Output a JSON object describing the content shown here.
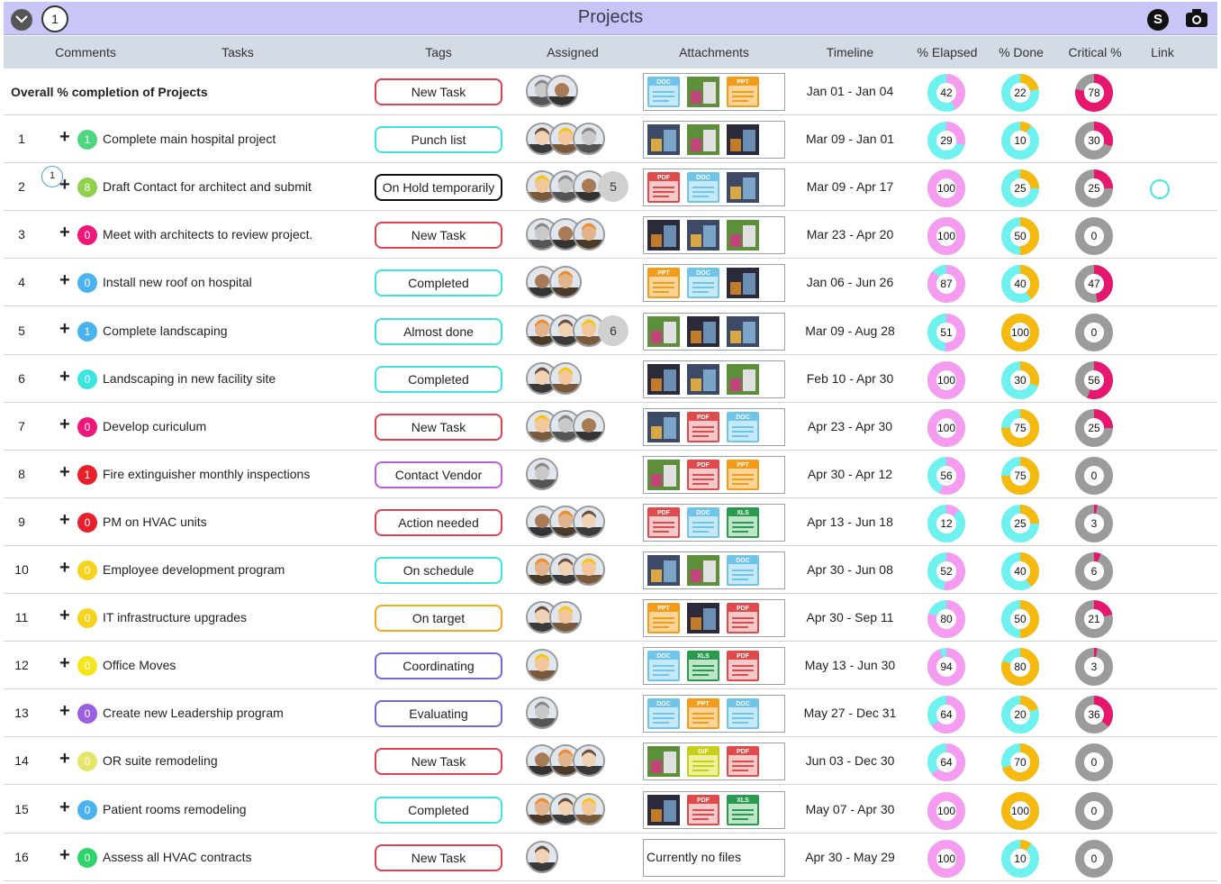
{
  "title": "Projects",
  "comment_count": "1",
  "skype_label": "S",
  "columns": [
    "Comments",
    "Tasks",
    "Tags",
    "Assigned",
    "Attachments",
    "Timeline",
    "% Elapsed",
    "% Done",
    "Critical %",
    "Link"
  ],
  "overall": {
    "label": "Overall % completion of Projects",
    "tag": "New Task",
    "timeline": "Jan 01 - Jan 04",
    "elapsed": 42,
    "done": 22,
    "critical": 78
  },
  "colors": {
    "red_tag": "#e0404f",
    "cyan_tag": "#3de3df",
    "purple_tag": "#b75fe0",
    "orange_tag": "#f5a81e",
    "indigo_tag": "#7b63dd",
    "black_tag": "#111111",
    "elapsed_pink": "#f59cf0",
    "elapsed_cyan": "#6ff2ef",
    "done_orange": "#f5b90f",
    "done_cyan": "#6ff2ef",
    "crit_pink": "#e5176e",
    "crit_gray": "#9b9b9b"
  },
  "rows": [
    {
      "num": "1",
      "badge": "1",
      "badge_color": "#4dd67f",
      "task": "Complete main hospital project",
      "tag": "Punch list",
      "tag_color": "#3de3df",
      "assigned": 3,
      "more": "",
      "files": [
        "photo",
        "photo",
        "photo"
      ],
      "timeline": "Mar 09 - Jan 01",
      "elapsed": 29,
      "done": 10,
      "critical": 30
    },
    {
      "num": "2",
      "badge": "8",
      "badge_color": "#8fd14f",
      "task": "Draft Contact for architect and submit",
      "tag": "On Hold temporarily",
      "tag_color": "#111111",
      "assigned": 3,
      "more": "5",
      "files": [
        "pdf",
        "doc",
        "photo"
      ],
      "timeline": "Mar 09 - Apr 17",
      "elapsed": 100,
      "done": 25,
      "critical": 25,
      "bubble": "1",
      "link": true
    },
    {
      "num": "3",
      "badge": "0",
      "badge_color": "#f0177a",
      "task": "Meet with architects to review project.",
      "tag": "New Task",
      "tag_color": "#e0404f",
      "assigned": 3,
      "more": "",
      "files": [
        "photo",
        "photo",
        "photo"
      ],
      "timeline": "Mar 23 - Apr 20",
      "elapsed": 100,
      "done": 50,
      "critical": 0
    },
    {
      "num": "4",
      "badge": "0",
      "badge_color": "#4ab3ef",
      "task": "Install new roof on hospital",
      "tag": "Completed",
      "tag_color": "#3de3df",
      "assigned": 2,
      "more": "",
      "files": [
        "ppt",
        "doc",
        "photo"
      ],
      "timeline": "Jan 06 - Jun 26",
      "elapsed": 87,
      "done": 40,
      "critical": 47
    },
    {
      "num": "5",
      "badge": "1",
      "badge_color": "#4ab3ef",
      "task": "Complete landscaping",
      "tag": "Almost done",
      "tag_color": "#3de3df",
      "assigned": 3,
      "more": "6",
      "files": [
        "photo",
        "photo",
        "photo"
      ],
      "timeline": "Mar 09 - Aug 28",
      "elapsed": 51,
      "done": 100,
      "critical": 0
    },
    {
      "num": "6",
      "badge": "0",
      "badge_color": "#3de3df",
      "task": "Landscaping in new facility site",
      "tag": "Completed",
      "tag_color": "#3de3df",
      "assigned": 2,
      "more": "",
      "files": [
        "photo",
        "photo",
        "photo"
      ],
      "timeline": "Feb 10 - Apr 30",
      "elapsed": 100,
      "done": 30,
      "critical": 56
    },
    {
      "num": "7",
      "badge": "0",
      "badge_color": "#f0177a",
      "task": "Develop curiculum",
      "tag": "New Task",
      "tag_color": "#e0404f",
      "assigned": 3,
      "more": "",
      "files": [
        "photo",
        "pdf",
        "doc"
      ],
      "timeline": "Apr 23 - Apr 30",
      "elapsed": 100,
      "done": 75,
      "critical": 25
    },
    {
      "num": "8",
      "badge": "1",
      "badge_color": "#e8202a",
      "task": "Fire extinguisher monthly inspections",
      "tag": "Contact Vendor",
      "tag_color": "#b75fe0",
      "assigned": 1,
      "more": "",
      "files": [
        "photo",
        "pdf",
        "ppt"
      ],
      "timeline": "Apr 30 - Apr 12",
      "elapsed": 56,
      "done": 75,
      "critical": 0
    },
    {
      "num": "9",
      "badge": "0",
      "badge_color": "#e8202a",
      "task": "PM on HVAC units",
      "tag": "Action needed",
      "tag_color": "#e0404f",
      "assigned": 3,
      "more": "",
      "files": [
        "pdf",
        "doc",
        "xls"
      ],
      "timeline": "Apr 13 - Jun 18",
      "elapsed": 12,
      "done": 25,
      "critical": 3
    },
    {
      "num": "10",
      "badge": "0",
      "badge_color": "#f5d31e",
      "task": "Employee development program",
      "tag": "On schedule",
      "tag_color": "#3de3df",
      "assigned": 3,
      "more": "",
      "files": [
        "photo",
        "photo",
        "doc"
      ],
      "timeline": "Apr 30 - Jun 08",
      "elapsed": 52,
      "done": 40,
      "critical": 6
    },
    {
      "num": "11",
      "badge": "0",
      "badge_color": "#f5d31e",
      "task": "IT infrastructure upgrades",
      "tag": "On target",
      "tag_color": "#f5a81e",
      "assigned": 2,
      "more": "",
      "files": [
        "ppt",
        "photo",
        "pdf"
      ],
      "timeline": "Apr 30 - Sep 11",
      "elapsed": 80,
      "done": 50,
      "critical": 21
    },
    {
      "num": "12",
      "badge": "0",
      "badge_color": "#f5e51e",
      "task": "Office Moves",
      "tag": "Coordinating",
      "tag_color": "#7b63dd",
      "assigned": 1,
      "more": "",
      "files": [
        "doc",
        "xls",
        "pdf"
      ],
      "timeline": "May 13 - Jun 30",
      "elapsed": 94,
      "done": 80,
      "critical": 3
    },
    {
      "num": "13",
      "badge": "0",
      "badge_color": "#9a5fe0",
      "task": "Create new Leadership program",
      "tag": "Evaluating",
      "tag_color": "#7b63dd",
      "assigned": 1,
      "more": "",
      "files": [
        "doc",
        "ppt",
        "doc"
      ],
      "timeline": "May 27 - Dec 31",
      "elapsed": 64,
      "done": 20,
      "critical": 36
    },
    {
      "num": "14",
      "badge": "0",
      "badge_color": "#e6e46a",
      "task": "OR suite remodeling",
      "tag": "New Task",
      "tag_color": "#e0404f",
      "assigned": 3,
      "more": "",
      "files": [
        "photo",
        "gif",
        "pdf"
      ],
      "timeline": "Jun 03 - Dec 30",
      "elapsed": 64,
      "done": 70,
      "critical": 0
    },
    {
      "num": "15",
      "badge": "0",
      "badge_color": "#4ab3ef",
      "task": "Patient rooms remodeling",
      "tag": "Completed",
      "tag_color": "#3de3df",
      "assigned": 3,
      "more": "",
      "files": [
        "photo",
        "pdf",
        "xls"
      ],
      "timeline": "May 07 - Apr 30",
      "elapsed": 100,
      "done": 100,
      "critical": 0
    },
    {
      "num": "16",
      "badge": "0",
      "badge_color": "#2ed36b",
      "task": "Assess all HVAC contracts",
      "tag": "New Task",
      "tag_color": "#e0404f",
      "assigned": 1,
      "more": "",
      "files": [],
      "no_files": "Currently no files",
      "timeline": "Apr 30 - May 29",
      "elapsed": 100,
      "done": 10,
      "critical": 0
    }
  ]
}
